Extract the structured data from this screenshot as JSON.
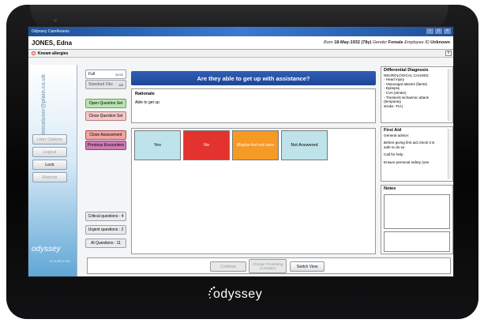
{
  "window": {
    "title": "Odyssey CareAssess"
  },
  "patient": {
    "name": "JONES, Edna",
    "born_label": "Born",
    "born_value": "18-May-1932 (78y)",
    "gender_label": "Gender",
    "gender_value": "Female",
    "employee_label": "Employee ID",
    "employee_value": "Unknown"
  },
  "allergies": {
    "label": "Known allergies"
  },
  "sidebar": {
    "email": "clinicaluser@plain.co.uk",
    "buttons": [
      "User Options",
      "Logout",
      "Lock",
      "Reports"
    ],
    "logo": "odyssey",
    "version": "5.3.1000.1736"
  },
  "nav": {
    "sets": [
      {
        "label": "Full",
        "count": "32/32"
      },
      {
        "label": "Standard Obs",
        "count": "8/8"
      }
    ],
    "open_question_set": "Open Question Set",
    "close_question_set": "Close Question Set",
    "close_assessment": "Close Assessment",
    "previous_encounters": "Previous Encounters",
    "critical_questions": "Critical questions : 4",
    "urgent_questions": "Urgent questions : 2",
    "all_questions": "Al Questions : 11"
  },
  "question": {
    "text": "Are they able to get up with assistance?"
  },
  "rationale": {
    "heading": "Rationale",
    "text": "Able to get up"
  },
  "answers": [
    {
      "label": "Yes",
      "color": "#bfe3ea"
    },
    {
      "label": "No",
      "color": "#e4332e"
    },
    {
      "label": "Maybe-but not sure",
      "color": "#f59a24"
    },
    {
      "label": "Not Answered",
      "color": "#bfe3ea"
    }
  ],
  "footer": {
    "continue": "Continue",
    "change_complaint": "Change Presenting Complaint",
    "switch_view": "Switch View"
  },
  "differential": {
    "title": "Differential Diagnosis",
    "lines": [
      "NEUROLOGICAL CAUSES:",
      "- Head injury",
      "- Vasovagal attacks (faints)",
      "- Epilepsy",
      "- CVA (stroke)",
      "- Transient ischaemic attack",
      "(temporary",
      "  stroke -TIA)"
    ]
  },
  "first_aid": {
    "title": "First Aid",
    "lines": [
      "General advice:",
      "",
      "Before giving first aid check it is",
      "safe to do so",
      "",
      "Call for help",
      "",
      "Ensure personal safety (use"
    ]
  },
  "notes": {
    "title": "Notes"
  },
  "device": {
    "brand": "odyssey"
  }
}
